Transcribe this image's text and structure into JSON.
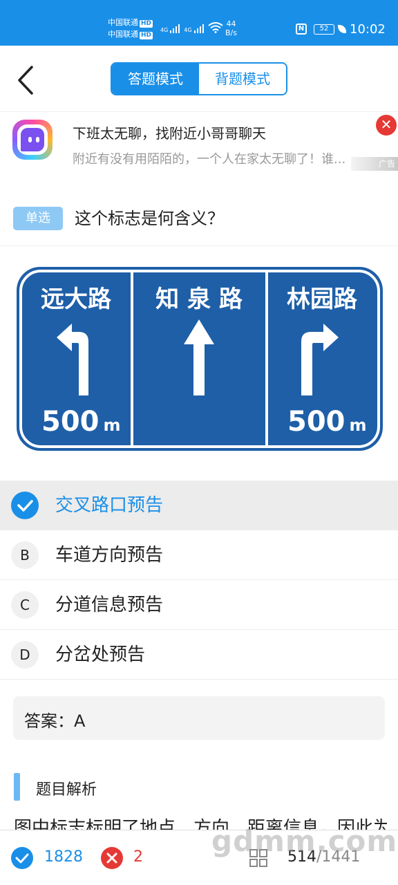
{
  "status_bar": {
    "carrier1": "中国联通",
    "carrier2": "中国联通",
    "hd": "HD",
    "network": "4G",
    "speed_value": "44",
    "speed_unit": "B/s",
    "nfc": "N",
    "battery": "52",
    "time": "10:02"
  },
  "topbar": {
    "modes": [
      {
        "label": "答题模式",
        "active": true
      },
      {
        "label": "背题模式",
        "active": false
      }
    ]
  },
  "ad": {
    "title": "下班太无聊，找附近小哥哥聊天",
    "description": "附近有没有用陌陌的，一个人在家太无聊了！谁...",
    "tag": "广告"
  },
  "question": {
    "type": "单选",
    "text": "这个标志是何含义？"
  },
  "sign": {
    "panels": [
      {
        "name": "远大路",
        "arrow": "left",
        "distance": "500",
        "unit": "m"
      },
      {
        "name": "知 泉 路",
        "arrow": "straight"
      },
      {
        "name": "林园路",
        "arrow": "right",
        "distance": "500",
        "unit": "m"
      }
    ],
    "color": "#1e5fa8"
  },
  "options": [
    {
      "letter": "A",
      "label": "交叉路口预告",
      "selected": true
    },
    {
      "letter": "B",
      "label": "车道方向预告",
      "selected": false
    },
    {
      "letter": "C",
      "label": "分道信息预告",
      "selected": false
    },
    {
      "letter": "D",
      "label": "分岔处预告",
      "selected": false
    }
  ],
  "answer": {
    "text": "答案：A"
  },
  "analysis": {
    "heading": "题目解析",
    "text": "图中标志标明了地点、方向、距离信息，因此为"
  },
  "bottom": {
    "correct_count": "1828",
    "wrong_count": "2",
    "current": "514",
    "total": "/1441"
  },
  "watermark": "gdmm.com",
  "colors": {
    "accent": "#1a8fe8",
    "wrong": "#e53935"
  }
}
